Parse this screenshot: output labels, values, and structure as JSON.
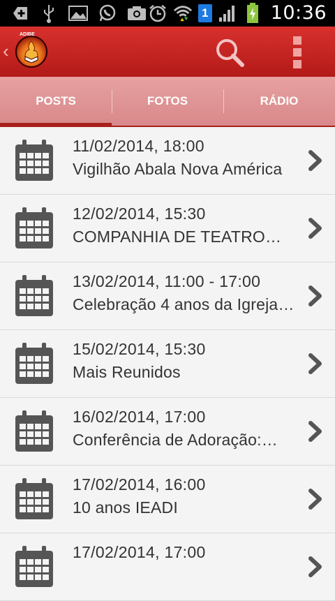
{
  "status_bar": {
    "time": "10:36",
    "sim_number": "1",
    "icons": [
      "add-icon",
      "usb-icon",
      "image-icon",
      "whatsapp-icon",
      "camera-icon",
      "alarm-icon",
      "wifi-icon",
      "sim-icon",
      "signal-icon",
      "battery-icon"
    ]
  },
  "action_bar": {
    "logo_text": "ADIBE",
    "icons": [
      "back-chevron-icon",
      "app-logo",
      "search-icon",
      "overflow-menu-icon"
    ]
  },
  "tabs": [
    {
      "label": "POSTS",
      "active": true
    },
    {
      "label": "FOTOS",
      "active": false
    },
    {
      "label": "RÁDIO",
      "active": false
    }
  ],
  "events": [
    {
      "date": "11/02/2014, 18:00",
      "title": "Vigilhão Abala Nova América"
    },
    {
      "date": "12/02/2014, 15:30",
      "title": "COMPANHIA DE TEATRO…"
    },
    {
      "date": "13/02/2014, 11:00 - 17:00",
      "title": "Celebração 4 anos da Igreja…"
    },
    {
      "date": "15/02/2014, 15:30",
      "title": "Mais Reunidos"
    },
    {
      "date": "16/02/2014, 17:00",
      "title": "Conferência de Adoração:…"
    },
    {
      "date": "17/02/2014, 16:00",
      "title": "10 anos IEADI"
    },
    {
      "date": "17/02/2014, 17:00",
      "title": ""
    }
  ],
  "colors": {
    "action_bar": "#c62828",
    "tab_bar": "#df9596",
    "tab_indicator": "#a8201c",
    "list_bg": "#f4f4f4",
    "icon_gray": "#555555"
  }
}
